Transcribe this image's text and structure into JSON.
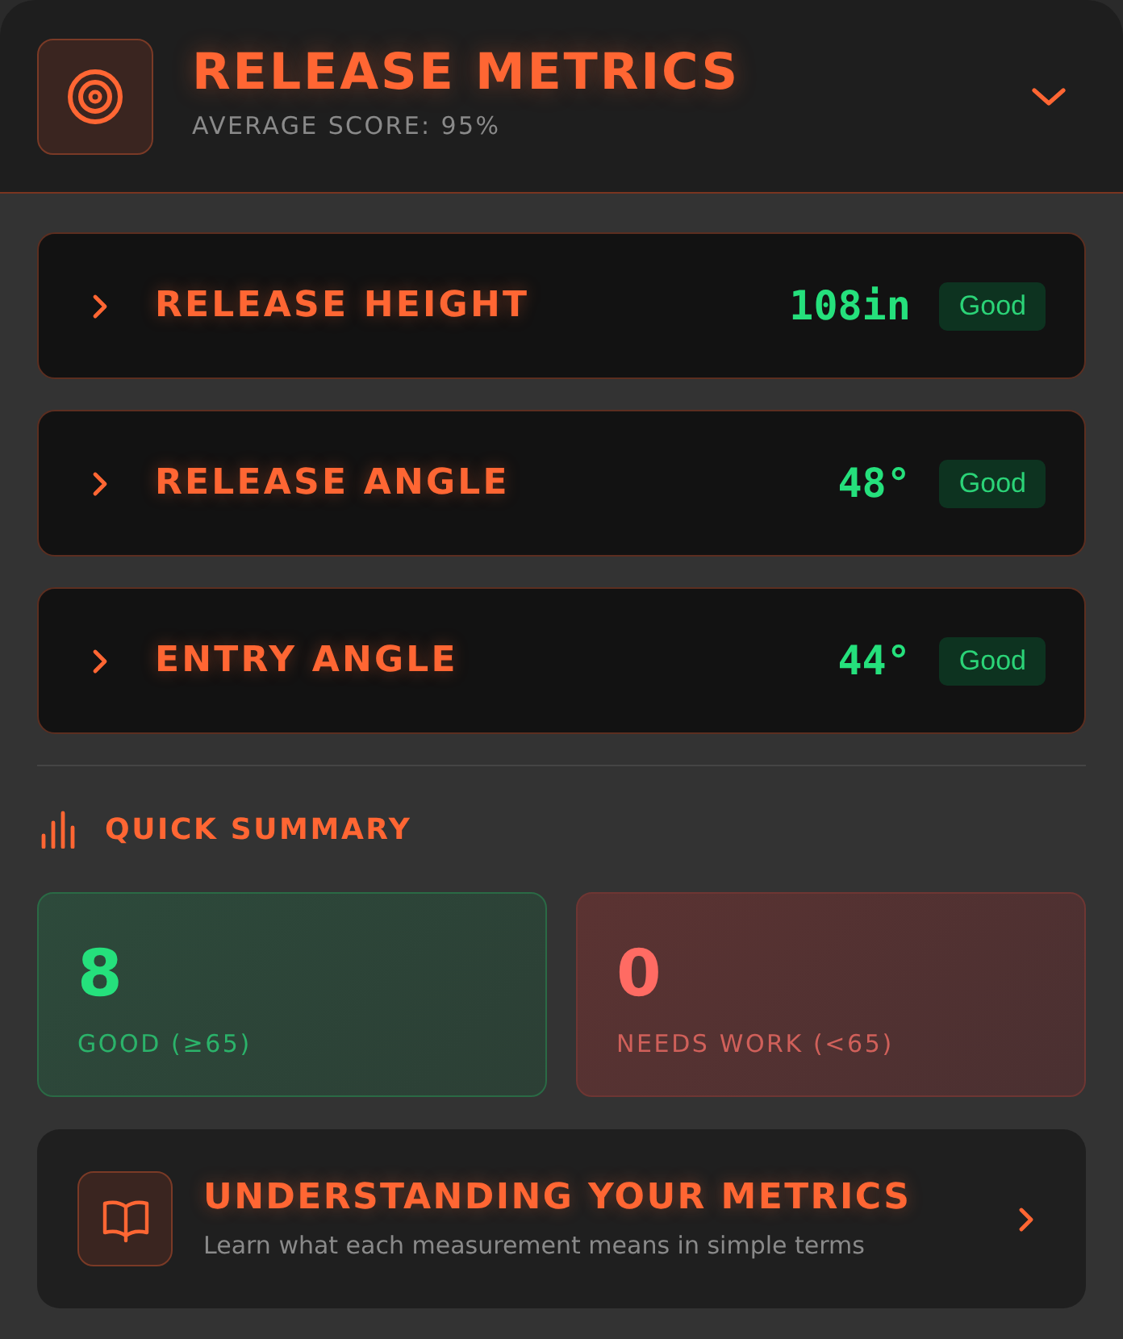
{
  "header": {
    "title": "RELEASE METRICS",
    "subtitle": "AVERAGE SCORE: 95%",
    "expanded": true
  },
  "metrics": [
    {
      "label": "RELEASE HEIGHT",
      "value": "108in",
      "status": "Good",
      "expanded": false
    },
    {
      "label": "RELEASE ANGLE",
      "value": "48°",
      "status": "Good",
      "expanded": false
    },
    {
      "label": "ENTRY ANGLE",
      "value": "44°",
      "status": "Good",
      "expanded": false
    }
  ],
  "summary": {
    "title": "QUICK SUMMARY",
    "cards": [
      {
        "kind": "good",
        "count": "8",
        "label": "GOOD (≥65)"
      },
      {
        "kind": "needs_work",
        "count": "0",
        "label": "NEEDS WORK (<65)"
      }
    ]
  },
  "guide": {
    "title": "UNDERSTANDING YOUR METRICS",
    "description": "Learn what each measurement means in simple terms"
  }
}
